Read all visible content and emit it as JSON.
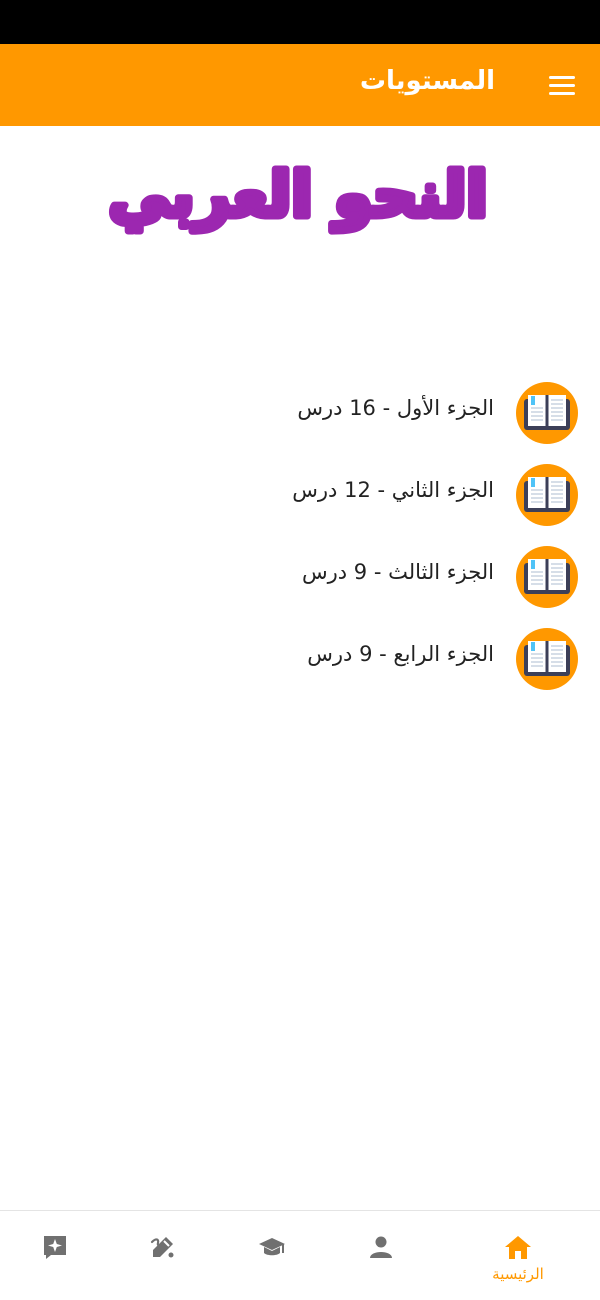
{
  "app_bar": {
    "title": "المستويات",
    "menu_icon": "hamburger-menu-icon",
    "background": "#FF9800"
  },
  "banner": {
    "text": "النحو العربي",
    "color": "#9C27B0"
  },
  "parts": [
    {
      "label": "الجزء الأول - 16 درس",
      "icon": "open-book-icon"
    },
    {
      "label": "الجزء الثاني - 12 درس",
      "icon": "open-book-icon"
    },
    {
      "label": "الجزء الثالث - 9 درس",
      "icon": "open-book-icon"
    },
    {
      "label": "الجزء الرابع - 9 درس",
      "icon": "open-book-icon"
    }
  ],
  "bottom_nav": {
    "active_color": "#FF9800",
    "inactive_color": "#707070",
    "items": [
      {
        "label": "",
        "icon": "sparkle-chat-icon"
      },
      {
        "label": "",
        "icon": "pencil-edit-icon"
      },
      {
        "label": "",
        "icon": "graduation-cap-icon"
      },
      {
        "label": "",
        "icon": "person-icon"
      },
      {
        "label": "الرئيسية",
        "icon": "home-icon",
        "active": true
      }
    ]
  }
}
